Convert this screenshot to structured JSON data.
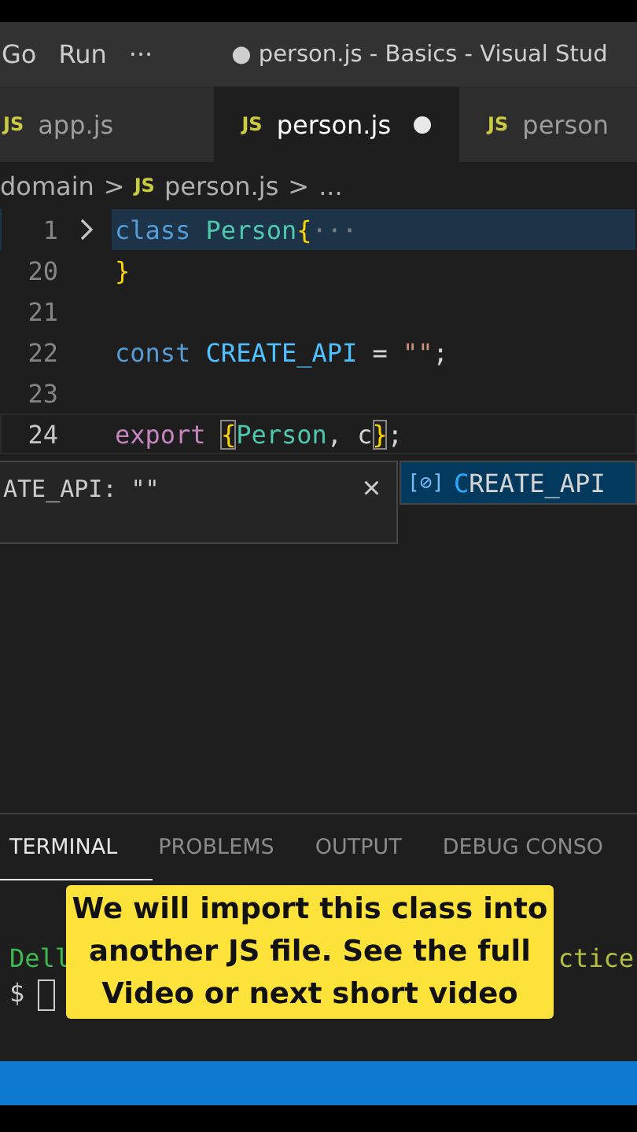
{
  "menu": [
    "Go",
    "Run",
    "···"
  ],
  "window": {
    "title": "● person.js - Basics - Visual Stud"
  },
  "tabs": [
    {
      "label": "app.js",
      "icon": "JS",
      "selected": false,
      "dirty": false
    },
    {
      "label": "person.js",
      "icon": "JS",
      "selected": true,
      "dirty": true
    },
    {
      "label": "person",
      "icon": "JS",
      "selected": false,
      "dirty": false
    }
  ],
  "breadcrumb": {
    "folder": "domain",
    "sep1": ">",
    "icon": "JS",
    "file": "person.js",
    "sep2": ">",
    "rest": "..."
  },
  "editor": {
    "lines": [
      {
        "number": "1",
        "folded": true,
        "current": false,
        "tokens": [
          {
            "kind": "keyword",
            "text": "class "
          },
          {
            "kind": "type",
            "text": "Person"
          },
          {
            "kind": "brace",
            "text": "{"
          },
          {
            "kind": "dim",
            "text": "···"
          }
        ]
      },
      {
        "number": "20",
        "folded": false,
        "current": false,
        "tokens": [
          {
            "kind": "brace",
            "text": "}"
          }
        ]
      },
      {
        "number": "21",
        "folded": false,
        "current": false
      },
      {
        "number": "22",
        "folded": false,
        "current": false,
        "tokens": [
          {
            "kind": "keyword",
            "text": "const "
          },
          {
            "kind": "constant",
            "text": "CREATE_API"
          },
          {
            "kind": "plain",
            "text": " = "
          },
          {
            "kind": "string",
            "text": "\"\""
          },
          {
            "kind": "plain",
            "text": ";"
          }
        ]
      },
      {
        "number": "23",
        "folded": false,
        "current": false
      },
      {
        "number": "24",
        "folded": false,
        "current": true,
        "tokens": [
          {
            "kind": "control",
            "text": "export "
          },
          {
            "kind": "brace-match",
            "text": "{"
          },
          {
            "kind": "type",
            "text": "Person"
          },
          {
            "kind": "plain",
            "text": ", c"
          },
          {
            "kind": "brace-match",
            "text": "}"
          },
          {
            "kind": "plain",
            "text": ";"
          }
        ]
      }
    ],
    "hover": {
      "text": "ATE_API: \"\"",
      "close": "×"
    },
    "suggestion": {
      "icon": "[⊘]",
      "match": "C",
      "rest": "REATE_API",
      "selected": true
    }
  },
  "panel": {
    "tabs": [
      {
        "label": "TERMINAL",
        "selected": true
      },
      {
        "label": "PROBLEMS",
        "selected": false
      },
      {
        "label": "OUTPUT",
        "selected": false
      },
      {
        "label": "DEBUG CONSO",
        "selected": false
      }
    ],
    "terminal": {
      "user": "Dell",
      "path": "ctice",
      "prompt": "$"
    }
  },
  "caption": "We will import this class into another JS file. See the full Video or next short video"
}
